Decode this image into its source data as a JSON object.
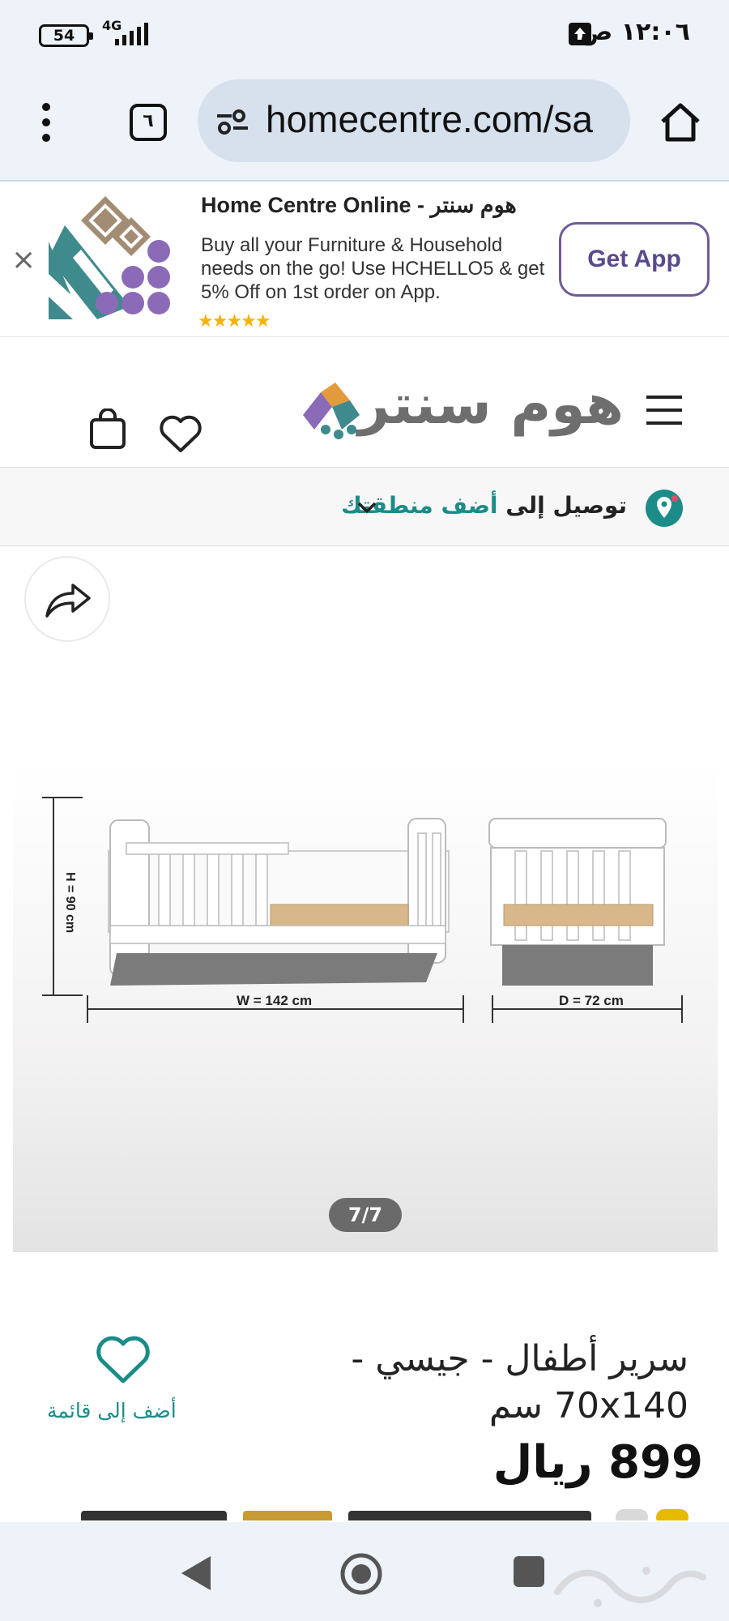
{
  "status_bar": {
    "battery": "54",
    "network": "4G",
    "time": "١٢:٠٦ ص"
  },
  "browser": {
    "url": "homecentre.com/sa",
    "tab_count": "٦"
  },
  "app_banner": {
    "title": "Home Centre Online - هوم سنتر",
    "description": "Buy all your Furniture & Household needs on the go! Use HCHELLO5 & get 5% Off on 1st order on App.",
    "rating_stars": "★★★★★",
    "cta": "Get App",
    "close": "×"
  },
  "header": {
    "logo_text": "هوم سنتر"
  },
  "delivery": {
    "prefix": "توصيل إلى",
    "area": "أضف منطقتك"
  },
  "gallery": {
    "counter": "7/7",
    "height_label": "H = 90 cm",
    "width_label": "W = 142 cm",
    "depth_label": "D = 72 cm"
  },
  "product": {
    "title": "سرير أطفال - جيسي - 70x140 سم",
    "price": "899 ريال",
    "wishlist_label": "أضف إلى قائمة"
  },
  "colors": {
    "teal": "#1b8c87",
    "purple": "#6f5c99",
    "gray_text": "#6e6e6e",
    "star": "#f6b400"
  }
}
